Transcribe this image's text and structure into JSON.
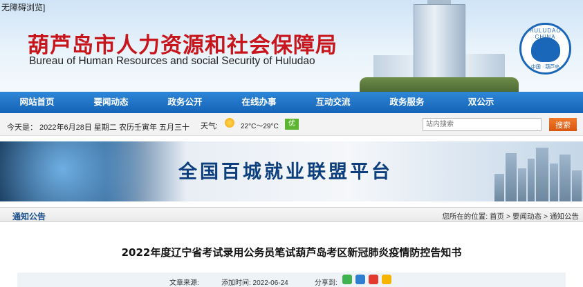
{
  "accessibility_link": "无障碍浏览]",
  "header": {
    "title_cn": "葫芦岛市人力资源和社会保障局",
    "title_en": "Bureau of Human Resources and social Security of Huludao",
    "logo_text_top": "HULUDAO CHINA",
    "logo_text_bottom": "中国 · 葫芦岛"
  },
  "nav": {
    "items": [
      "网站首页",
      "要闻动态",
      "政务公开",
      "在线办事",
      "互动交流",
      "政务服务",
      "双公示"
    ]
  },
  "infobar": {
    "date": "今天是：  2022年6月28日 星期二 农历壬寅年 五月三十",
    "weather_label": "天气:",
    "temperature": "22°C～29°C",
    "air_quality": "优",
    "search_placeholder": "站内搜索",
    "search_button": "搜索"
  },
  "banner": {
    "text": "全国百城就业联盟平台"
  },
  "breadcrumb": {
    "section": "通知公告",
    "path": "您所在的位置:  首页 > 要闻动态 > 通知公告"
  },
  "article": {
    "title": "2022年度辽宁省考试录用公务员笔试葫芦岛考区新冠肺炎疫情防控告知书",
    "source_label": "文章来源:",
    "date_label": "添加时间: 2022-06-24",
    "share_label": "分享到:"
  },
  "colors": {
    "nav_blue": "#1463b8",
    "title_red": "#c8141b",
    "search_orange": "#d9560e"
  }
}
